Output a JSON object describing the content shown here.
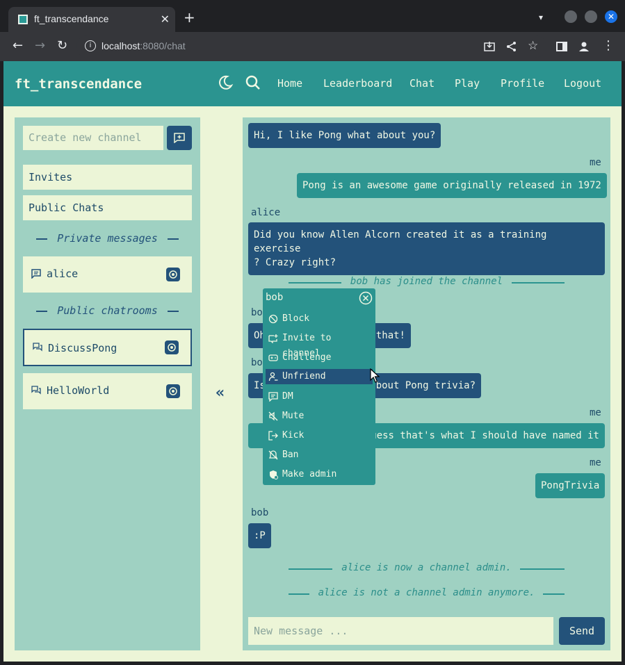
{
  "browser": {
    "tab_title": "ft_transcendance",
    "url_host": "localhost",
    "url_rest": ":8080/chat"
  },
  "header": {
    "brand": "ft_transcendance",
    "nav": [
      "Home",
      "Leaderboard",
      "Chat",
      "Play",
      "Profile",
      "Logout"
    ]
  },
  "sidebar": {
    "new_channel_placeholder": "Create new channel",
    "invites": "Invites",
    "public_chats": "Public Chats",
    "private_title": "Private messages",
    "private": [
      {
        "label": "alice"
      }
    ],
    "public_title": "Public chatrooms",
    "rooms": [
      {
        "label": "DiscussPong"
      },
      {
        "label": "HelloWorld"
      }
    ],
    "collapse_glyph": "«"
  },
  "chat": {
    "messages": [
      {
        "sender": "",
        "text": "Hi, I like Pong what about you?"
      },
      {
        "sender": "me",
        "text": "Pong is an awesome game originally released in 1972"
      },
      {
        "sender": "alice",
        "text_line1": "Did you know Allen Alcorn created it as a training exercise",
        "text_line2": "? Crazy right?"
      },
      {
        "system": "bob has joined the channel"
      },
      {
        "sender": "bo",
        "text": "Oh",
        "text_tail": "that!"
      },
      {
        "sender": "bo",
        "text": "Is",
        "text_tail": "bout Pong trivia?"
      },
      {
        "sender": "me",
        "text": "uess that's what I should have named it"
      },
      {
        "sender": "me",
        "text": "PongTrivia"
      },
      {
        "sender": "bob",
        "text": ":P"
      },
      {
        "system": "alice is now a channel admin."
      },
      {
        "system": "alice is not a channel admin anymore."
      }
    ],
    "input_placeholder": "New message ...",
    "send_label": "Send"
  },
  "context_menu": {
    "title": "bob",
    "items": [
      {
        "label": "Block",
        "icon": "block-icon"
      },
      {
        "label": "Invite to channel",
        "icon": "invite-icon"
      },
      {
        "label": "Challenge",
        "icon": "gamepad-icon"
      },
      {
        "label": "Unfriend",
        "icon": "unfriend-icon"
      },
      {
        "label": "DM",
        "icon": "dm-icon"
      },
      {
        "label": "Mute",
        "icon": "mute-icon"
      },
      {
        "label": "Kick",
        "icon": "kick-icon"
      },
      {
        "label": "Ban",
        "icon": "ban-icon"
      },
      {
        "label": "Make admin",
        "icon": "shield-icon"
      }
    ],
    "hovered_index": 3
  },
  "colors": {
    "primary": "#2b9490",
    "dark": "#23527a",
    "panel": "#9fd1c2",
    "background": "#ecf5d7"
  }
}
